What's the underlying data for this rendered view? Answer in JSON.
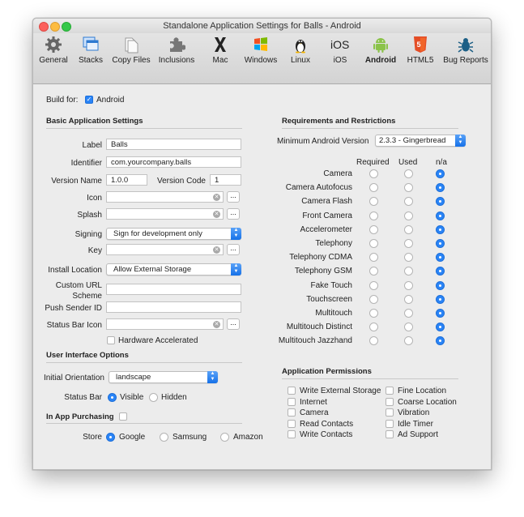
{
  "window": {
    "title": "Standalone Application Settings for Balls - Android"
  },
  "toolbar": {
    "items": [
      {
        "label": "General",
        "icon": "gear-icon"
      },
      {
        "label": "Stacks",
        "icon": "stacks-icon"
      },
      {
        "label": "Copy Files",
        "icon": "copy-files-icon"
      },
      {
        "label": "Inclusions",
        "icon": "puzzle-icon"
      },
      {
        "label": "Mac",
        "icon": "mac-x-icon"
      },
      {
        "label": "Windows",
        "icon": "windows-icon"
      },
      {
        "label": "Linux",
        "icon": "linux-penguin-icon"
      },
      {
        "label": "iOS",
        "icon": "ios-icon"
      },
      {
        "label": "Android",
        "icon": "android-icon"
      },
      {
        "label": "HTML5",
        "icon": "html5-icon"
      },
      {
        "label": "Bug Reports",
        "icon": "bug-icon"
      }
    ],
    "selected": "Android"
  },
  "build_for": {
    "label": "Build for:",
    "option": "Android",
    "checked": true
  },
  "basic": {
    "heading": "Basic Application Settings",
    "label_label": "Label",
    "label_value": "Balls",
    "identifier_label": "Identifier",
    "identifier_value": "com.yourcompany.balls",
    "version_name_label": "Version Name",
    "version_name_value": "1.0.0",
    "version_code_label": "Version Code",
    "version_code_value": "1",
    "icon_label": "Icon",
    "splash_label": "Splash",
    "signing_label": "Signing",
    "signing_value": "Sign for development only",
    "key_label": "Key",
    "install_location_label": "Install Location",
    "install_location_value": "Allow External Storage",
    "custom_url_label_1": "Custom URL",
    "custom_url_label_2": "Scheme",
    "push_sender_label": "Push Sender ID",
    "status_bar_icon_label": "Status Bar Icon",
    "hardware_accelerated_label": "Hardware Accelerated",
    "browse_label": "..."
  },
  "ui_options": {
    "heading": "User Interface Options",
    "orientation_label": "Initial Orientation",
    "orientation_value": "landscape",
    "status_bar_label": "Status Bar",
    "visible_label": "Visible",
    "hidden_label": "Hidden",
    "status_bar_selected": "Visible"
  },
  "iap": {
    "heading": "In App Purchasing",
    "enabled": false,
    "store_label": "Store",
    "stores": [
      "Google",
      "Samsung",
      "Amazon"
    ],
    "selected_store": "Google"
  },
  "requirements": {
    "heading": "Requirements and Restrictions",
    "min_version_label": "Minimum Android Version",
    "min_version_value": "2.3.3 - Gingerbread",
    "columns": [
      "Required",
      "Used",
      "n/a"
    ],
    "features": [
      {
        "name": "Camera",
        "state": "n/a"
      },
      {
        "name": "Camera Autofocus",
        "state": "n/a"
      },
      {
        "name": "Camera Flash",
        "state": "n/a"
      },
      {
        "name": "Front Camera",
        "state": "n/a"
      },
      {
        "name": "Accelerometer",
        "state": "n/a"
      },
      {
        "name": "Telephony",
        "state": "n/a"
      },
      {
        "name": "Telephony CDMA",
        "state": "n/a"
      },
      {
        "name": "Telephony GSM",
        "state": "n/a"
      },
      {
        "name": "Fake Touch",
        "state": "n/a"
      },
      {
        "name": "Touchscreen",
        "state": "n/a"
      },
      {
        "name": "Multitouch",
        "state": "n/a"
      },
      {
        "name": "Multitouch Distinct",
        "state": "n/a"
      },
      {
        "name": "Multitouch Jazzhand",
        "state": "n/a"
      }
    ]
  },
  "permissions": {
    "heading": "Application Permissions",
    "left": [
      "Write External Storage",
      "Internet",
      "Camera",
      "Read Contacts",
      "Write Contacts"
    ],
    "right": [
      "Fine Location",
      "Coarse Location",
      "Vibration",
      "Idle Timer",
      "Ad Support"
    ]
  },
  "colors": {
    "accent": "#2a84f6",
    "window_bg": "#ececec"
  }
}
